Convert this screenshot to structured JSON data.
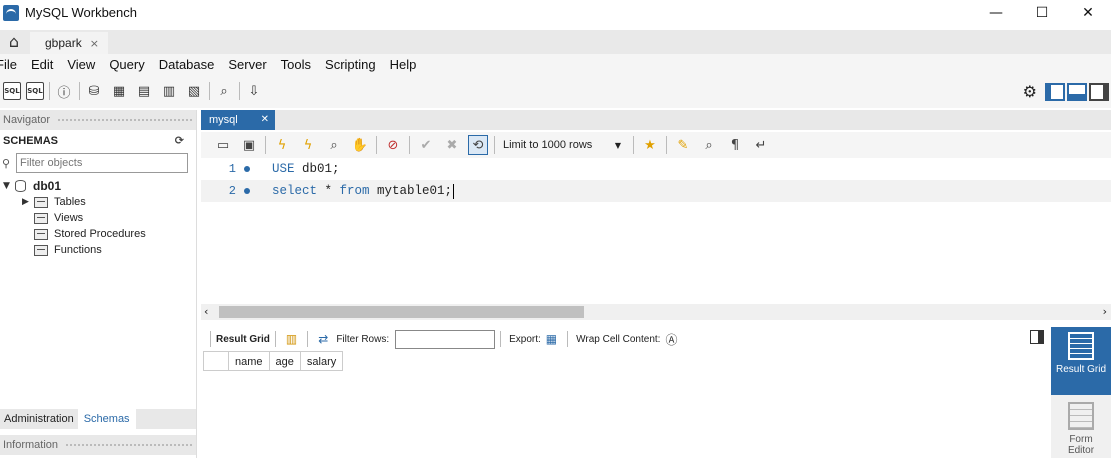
{
  "window": {
    "title": "MySQL Workbench",
    "minimize": "—",
    "maximize": "☐",
    "close": "✕"
  },
  "connection_tab": {
    "label": "gbpark",
    "close": "×"
  },
  "menu": [
    "File",
    "Edit",
    "View",
    "Query",
    "Database",
    "Server",
    "Tools",
    "Scripting",
    "Help"
  ],
  "main_toolbar": {
    "sql_label": "SQL"
  },
  "navigator": {
    "header": "Navigator",
    "schemas_title": "SCHEMAS",
    "filter_placeholder": "Filter objects",
    "database": "db01",
    "children": [
      "Tables",
      "Views",
      "Stored Procedures",
      "Functions"
    ],
    "tabs": [
      "Administration",
      "Schemas"
    ],
    "active_tab": "Schemas",
    "info_header": "Information"
  },
  "editor": {
    "tab_label": "mysql",
    "tab_close": "✕",
    "limit_label": "Limit to 1000 rows",
    "lines": [
      {
        "number": "1",
        "keyword": "USE",
        "rest": " db01;"
      },
      {
        "number": "2",
        "keyword": "select",
        "rest": " * ",
        "keyword2": "from",
        "rest2": " mytable01;"
      }
    ]
  },
  "result": {
    "result_grid_label": "Result Grid",
    "filter_rows_label": "Filter Rows:",
    "export_label": "Export:",
    "wrap_label": "Wrap Cell Content:",
    "columns": [
      "name",
      "age",
      "salary"
    ]
  },
  "side_panel": {
    "result_grid": "Result Grid",
    "form_editor": "Form Editor"
  },
  "colors": {
    "accent": "#2b6aa8"
  }
}
